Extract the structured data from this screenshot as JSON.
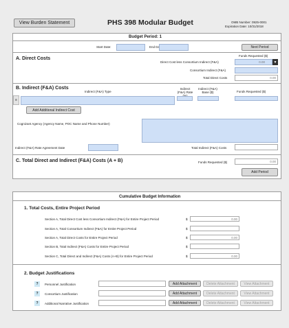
{
  "header": {
    "burden_button": "View Burden Statement",
    "title": "PHS 398 Modular Budget",
    "omb_number": "OMB Number: 0925-0001",
    "expiration": "Expiration Date: 10/31/2018"
  },
  "budget_period": {
    "heading": "Budget Period: 1",
    "start_label": "Start Date:",
    "end_label": "End Date:",
    "next_button": "Next Period"
  },
  "direct_costs": {
    "heading": "A. Direct Costs",
    "funds_requested_label": "Funds Requested ($)",
    "less_indirect_label": "Direct Cost less Consortium Indirect (F&A)",
    "less_indirect_value": "0.00",
    "consortium_label": "Consortium Indirect (F&A)",
    "total_label": "Total Direct Costs",
    "total_value": "0.00"
  },
  "indirect_costs": {
    "heading": "B. Indirect (F&A) Costs",
    "col_type": "Indirect (F&A) Type",
    "col_rate": "Indirect (F&A) Rate (%)",
    "col_base": "Indirect (F&A) Base ($)",
    "col_funds": "Funds Requested ($)",
    "add_button": "Add Additional Indirect Cost",
    "agency_label": "Cognizant Agency (Agency Name, POC Name and Phone Number)",
    "rate_date_label": "Indirect (F&A) Rate Agreement Date",
    "total_label": "Total Indirect (F&A) Costs"
  },
  "total_costs": {
    "heading": "C. Total Direct and Indirect (F&A) Costs (A + B)",
    "funds_label": "Funds Requested ($)",
    "funds_value": "0.00",
    "add_period_button": "Add Period"
  },
  "cumulative": {
    "heading": "Cumulative Budget Information",
    "section1_heading": "1. Total Costs, Entire Project Period",
    "rows": [
      {
        "label": "Section A, Total Direct Cost less Consortium Indirect (F&A) for Entire Project Period",
        "currency": "$",
        "value": "0.00"
      },
      {
        "label": "Section A, Total Consortium Indirect (F&A) for Entire Project Period",
        "currency": "$",
        "value": ""
      },
      {
        "label": "Section A, Total Direct Costs for Entire Project Period",
        "currency": "$",
        "value": "0.00"
      },
      {
        "label": "Section B, Total Indirect (F&A) Costs for Entire Project Period",
        "currency": "$",
        "value": ""
      },
      {
        "label": "Section C, Total Direct and Indirect (F&A) Costs (A+B) for Entire Project Period",
        "currency": "$",
        "value": "0.00"
      }
    ],
    "section2_heading": "2. Budget Justifications",
    "justifications": [
      {
        "label": "Personnel Justification"
      },
      {
        "label": "Consortium Justification"
      },
      {
        "label": "Additional Narrative Justification"
      }
    ],
    "add_attachment": "Add Attachment",
    "delete_attachment": "Delete Attachment",
    "view_attachment": "View Attachment",
    "help_glyph": "?"
  }
}
